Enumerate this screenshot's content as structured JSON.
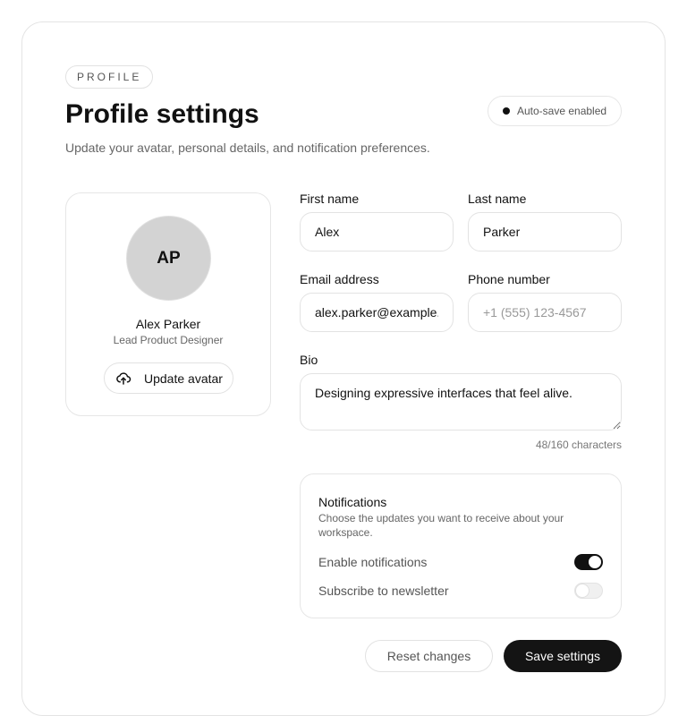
{
  "header": {
    "eyebrow": "PROFILE",
    "title": "Profile settings",
    "subtitle": "Update your avatar, personal details, and notification preferences.",
    "autosave_label": "Auto-save enabled"
  },
  "avatar_card": {
    "initials": "AP",
    "name": "Alex Parker",
    "role": "Lead Product Designer",
    "update_button_label": "Update avatar",
    "button_icon": "upload-cloud-icon"
  },
  "form": {
    "first_name": {
      "label": "First name",
      "value": "Alex"
    },
    "last_name": {
      "label": "Last name",
      "value": "Parker"
    },
    "email": {
      "label": "Email address",
      "value": "alex.parker@example.com"
    },
    "phone": {
      "label": "Phone number",
      "value": "",
      "placeholder": "+1 (555) 123-4567"
    },
    "bio": {
      "label": "Bio",
      "value": "Designing expressive interfaces that feel alive.",
      "counter": "48/160 characters"
    }
  },
  "notifications": {
    "title": "Notifications",
    "description": "Choose the updates you want to receive about your workspace.",
    "options": [
      {
        "label": "Enable notifications",
        "enabled": true
      },
      {
        "label": "Subscribe to newsletter",
        "enabled": false
      }
    ]
  },
  "actions": {
    "reset_label": "Reset changes",
    "save_label": "Save settings"
  },
  "colors": {
    "accent": "#141414",
    "border": "#e4e4e4",
    "avatar_bg": "#d3d3d3"
  }
}
